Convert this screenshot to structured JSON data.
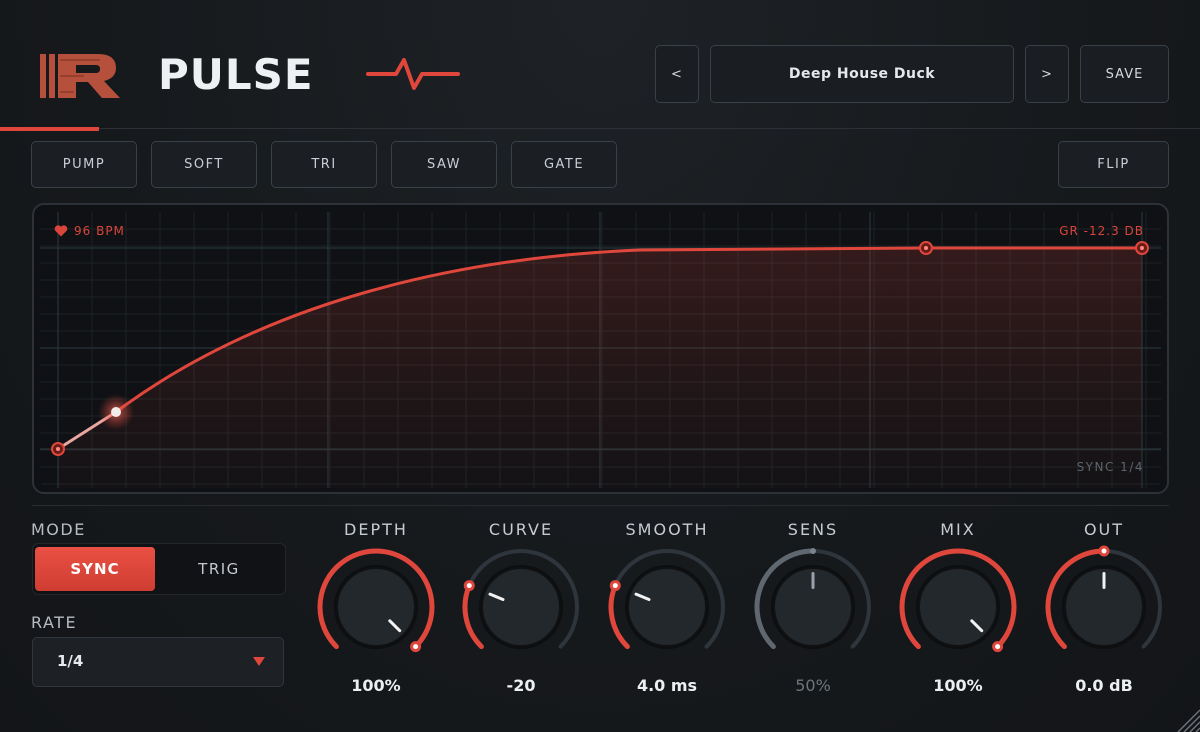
{
  "app": {
    "title": "PULSE"
  },
  "header": {
    "prev_label": "<",
    "preset_name": "Deep House Duck",
    "next_label": ">",
    "save_label": "SAVE"
  },
  "shapes": [
    "PUMP",
    "SOFT",
    "TRI",
    "SAW",
    "GATE"
  ],
  "flip_label": "FLIP",
  "graph": {
    "bpm_label": "96 BPM",
    "gr_label": "GR -12.3 DB",
    "sync_label": "SYNC  1/4"
  },
  "mode": {
    "label": "MODE",
    "options": [
      "SYNC",
      "TRIG"
    ],
    "selected": "SYNC"
  },
  "rate": {
    "label": "RATE",
    "value": "1/4"
  },
  "knobs": [
    {
      "name": "depth",
      "label": "DEPTH",
      "value": "100%",
      "level": 1.0,
      "active": true
    },
    {
      "name": "curve",
      "label": "CURVE",
      "value": "-20",
      "level": 0.25,
      "active": true
    },
    {
      "name": "smooth",
      "label": "SMOOTH",
      "value": "4.0 ms",
      "level": 0.25,
      "active": true
    },
    {
      "name": "sens",
      "label": "SENS",
      "value": "50%",
      "level": 0.5,
      "active": false
    },
    {
      "name": "mix",
      "label": "MIX",
      "value": "100%",
      "level": 1.0,
      "active": true
    },
    {
      "name": "out",
      "label": "OUT",
      "value": "0.0 dB",
      "level": 0.5,
      "active": true
    }
  ],
  "colors": {
    "accent": "#e0473c",
    "background": "#16191d",
    "text": "#e6e9ec"
  }
}
